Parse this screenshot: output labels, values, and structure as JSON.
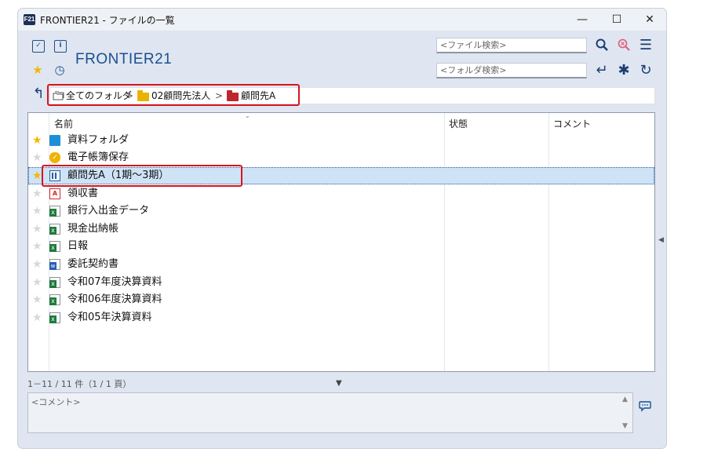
{
  "window": {
    "app_icon": "F21",
    "title": "FRONTIER21 - ファイルの一覧",
    "minimize": "—",
    "maximize": "☐",
    "close": "✕"
  },
  "toolbar": {
    "brand": "FRONTIER21",
    "file_search_placeholder": "<ファイル検索>",
    "folder_search_placeholder": "<フォルダ検索>",
    "icons": [
      "doc-check-icon",
      "info-icon",
      "star-icon",
      "history-icon",
      "search-icon",
      "search-clear-icon",
      "menu-icon",
      "enter-icon",
      "asterisk-icon",
      "refresh-icon",
      "back-icon"
    ]
  },
  "breadcrumb": {
    "items": [
      {
        "label": "全てのフォルダ",
        "icon": "all-folders-icon"
      },
      {
        "label": "02顧問先法人",
        "icon": "folder-yellow-icon",
        "color": "#e9b100"
      },
      {
        "label": "顧問先A",
        "icon": "folder-red-icon",
        "color": "#c0272d"
      }
    ],
    "separator": ">"
  },
  "table": {
    "columns": [
      "名前",
      "状態",
      "コメント"
    ],
    "rows": [
      {
        "name": "資料フォルダ",
        "starred": true,
        "icon": "folder-icon",
        "selected": false
      },
      {
        "name": "電子帳簿保存",
        "starred": false,
        "icon": "shield-icon",
        "selected": false
      },
      {
        "name": "顧問先A（1期～3期）",
        "starred": true,
        "icon": "building-icon",
        "selected": true
      },
      {
        "name": "領収書",
        "starred": false,
        "icon": "pdf-icon",
        "selected": false
      },
      {
        "name": "銀行入出金データ",
        "starred": false,
        "icon": "excel-icon",
        "selected": false
      },
      {
        "name": "現金出納帳",
        "starred": false,
        "icon": "excel-icon",
        "selected": false
      },
      {
        "name": "日報",
        "starred": false,
        "icon": "excel-icon",
        "selected": false
      },
      {
        "name": "委託契約書",
        "starred": false,
        "icon": "word-icon",
        "selected": false
      },
      {
        "name": "令和07年度決算資料",
        "starred": false,
        "icon": "excel-icon",
        "selected": false
      },
      {
        "name": "令和06年度決算資料",
        "starred": false,
        "icon": "excel-icon",
        "selected": false
      },
      {
        "name": "令和05年決算資料",
        "starred": false,
        "icon": "excel-icon",
        "selected": false
      }
    ]
  },
  "status": {
    "count": "1－11 / 11 件（1 / 1 頁）"
  },
  "comment": {
    "placeholder": "<コメント>"
  },
  "colors": {
    "highlight": "#d8151c",
    "star_on": "#f4b700",
    "accent": "#1b4f8e"
  }
}
